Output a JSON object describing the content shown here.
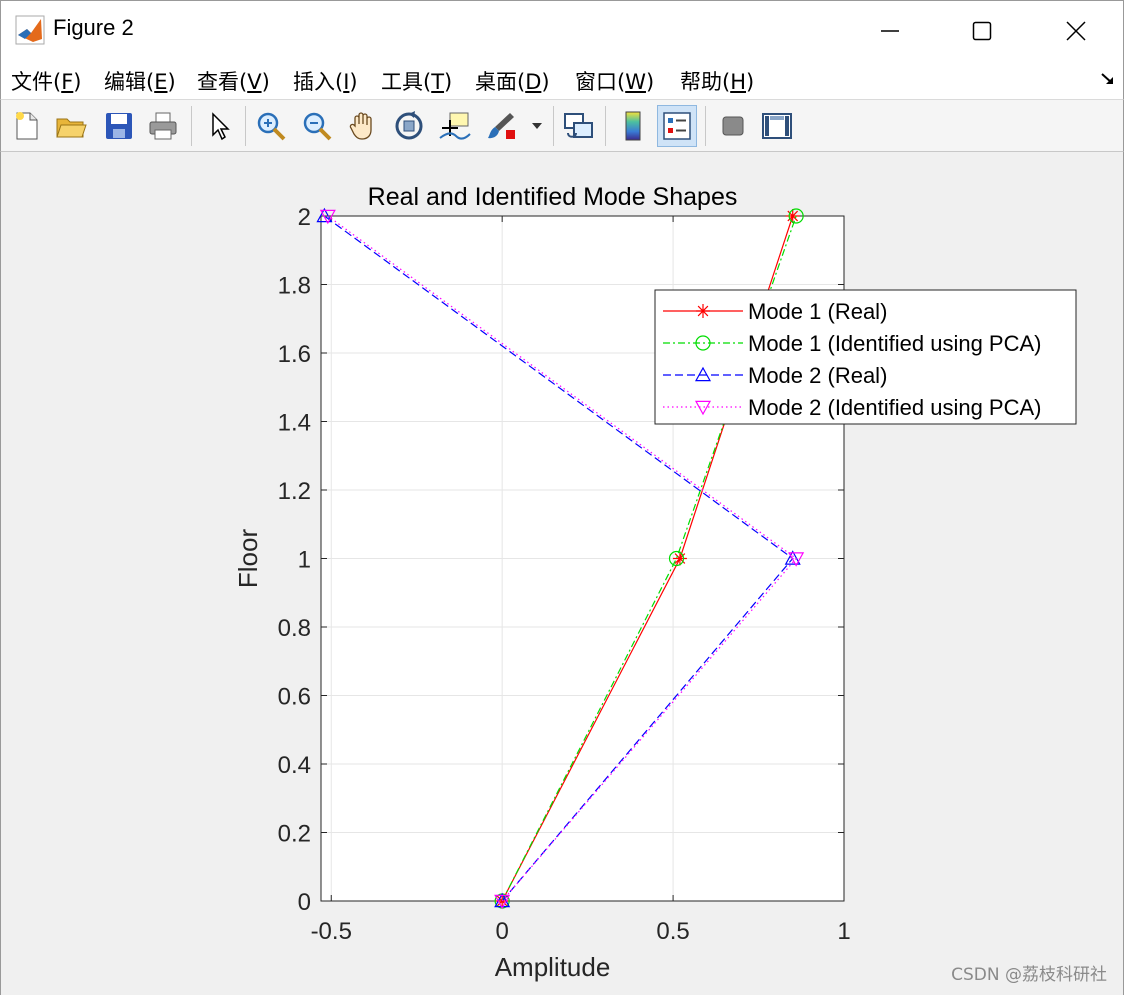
{
  "window": {
    "title": "Figure 2"
  },
  "menu": {
    "items": [
      {
        "label": "文件(",
        "key": "F",
        "tail": ")"
      },
      {
        "label": "编辑(",
        "key": "E",
        "tail": ")"
      },
      {
        "label": "查看(",
        "key": "V",
        "tail": ")"
      },
      {
        "label": "插入(",
        "key": "I",
        "tail": ")"
      },
      {
        "label": "工具(",
        "key": "T",
        "tail": ")"
      },
      {
        "label": "桌面(",
        "key": "D",
        "tail": ")"
      },
      {
        "label": "窗口(",
        "key": "W",
        "tail": ")"
      },
      {
        "label": "帮助(",
        "key": "H",
        "tail": ")"
      }
    ]
  },
  "toolbar": {
    "icons": [
      "new-figure-icon",
      "open-file-icon",
      "save-icon",
      "print-icon",
      "select-arrow-icon",
      "zoom-in-icon",
      "zoom-out-icon",
      "pan-hand-icon",
      "rotate-3d-icon",
      "data-cursor-icon",
      "brush-icon",
      "link-plot-icon",
      "colorbar-icon",
      "legend-icon",
      "hide-plot-tools-icon",
      "show-plot-tools-icon"
    ],
    "active": "legend-icon"
  },
  "watermark": "CSDN @荔枝科研社",
  "colors": {
    "mode1_real": "#ff0000",
    "mode1_pca": "#00dd00",
    "mode2_real": "#0000ff",
    "mode2_pca": "#ff00ff"
  },
  "chart_data": {
    "type": "line",
    "title": "Real and Identified Mode Shapes",
    "xlabel": "Amplitude",
    "ylabel": "Floor",
    "xlim": [
      -0.53,
      1
    ],
    "ylim": [
      0,
      2
    ],
    "xticks": [
      "-0.5",
      "0",
      "0.5",
      "1"
    ],
    "yticks": [
      "0",
      "0.2",
      "0.4",
      "0.6",
      "0.8",
      "1",
      "1.2",
      "1.4",
      "1.6",
      "1.8",
      "2"
    ],
    "grid": true,
    "legend_position": "top-right",
    "series": [
      {
        "name": "Mode 1 (Real)",
        "x": [
          0,
          0.52,
          0.85
        ],
        "y": [
          0,
          1,
          2
        ],
        "color": "#ff0000",
        "line": "solid",
        "marker": "star"
      },
      {
        "name": "Mode 1 (Identified using PCA)",
        "x": [
          0,
          0.51,
          0.86
        ],
        "y": [
          0,
          1,
          2
        ],
        "color": "#00dd00",
        "line": "dashdot",
        "marker": "circle"
      },
      {
        "name": "Mode 2 (Real)",
        "x": [
          0,
          0.85,
          -0.52
        ],
        "y": [
          0,
          1,
          2
        ],
        "color": "#0000ff",
        "line": "dashed",
        "marker": "triangle-up"
      },
      {
        "name": "Mode 2 (Identified using PCA)",
        "x": [
          0,
          0.86,
          -0.51
        ],
        "y": [
          0,
          1,
          2
        ],
        "color": "#ff00ff",
        "line": "dotted",
        "marker": "triangle-down"
      }
    ]
  }
}
